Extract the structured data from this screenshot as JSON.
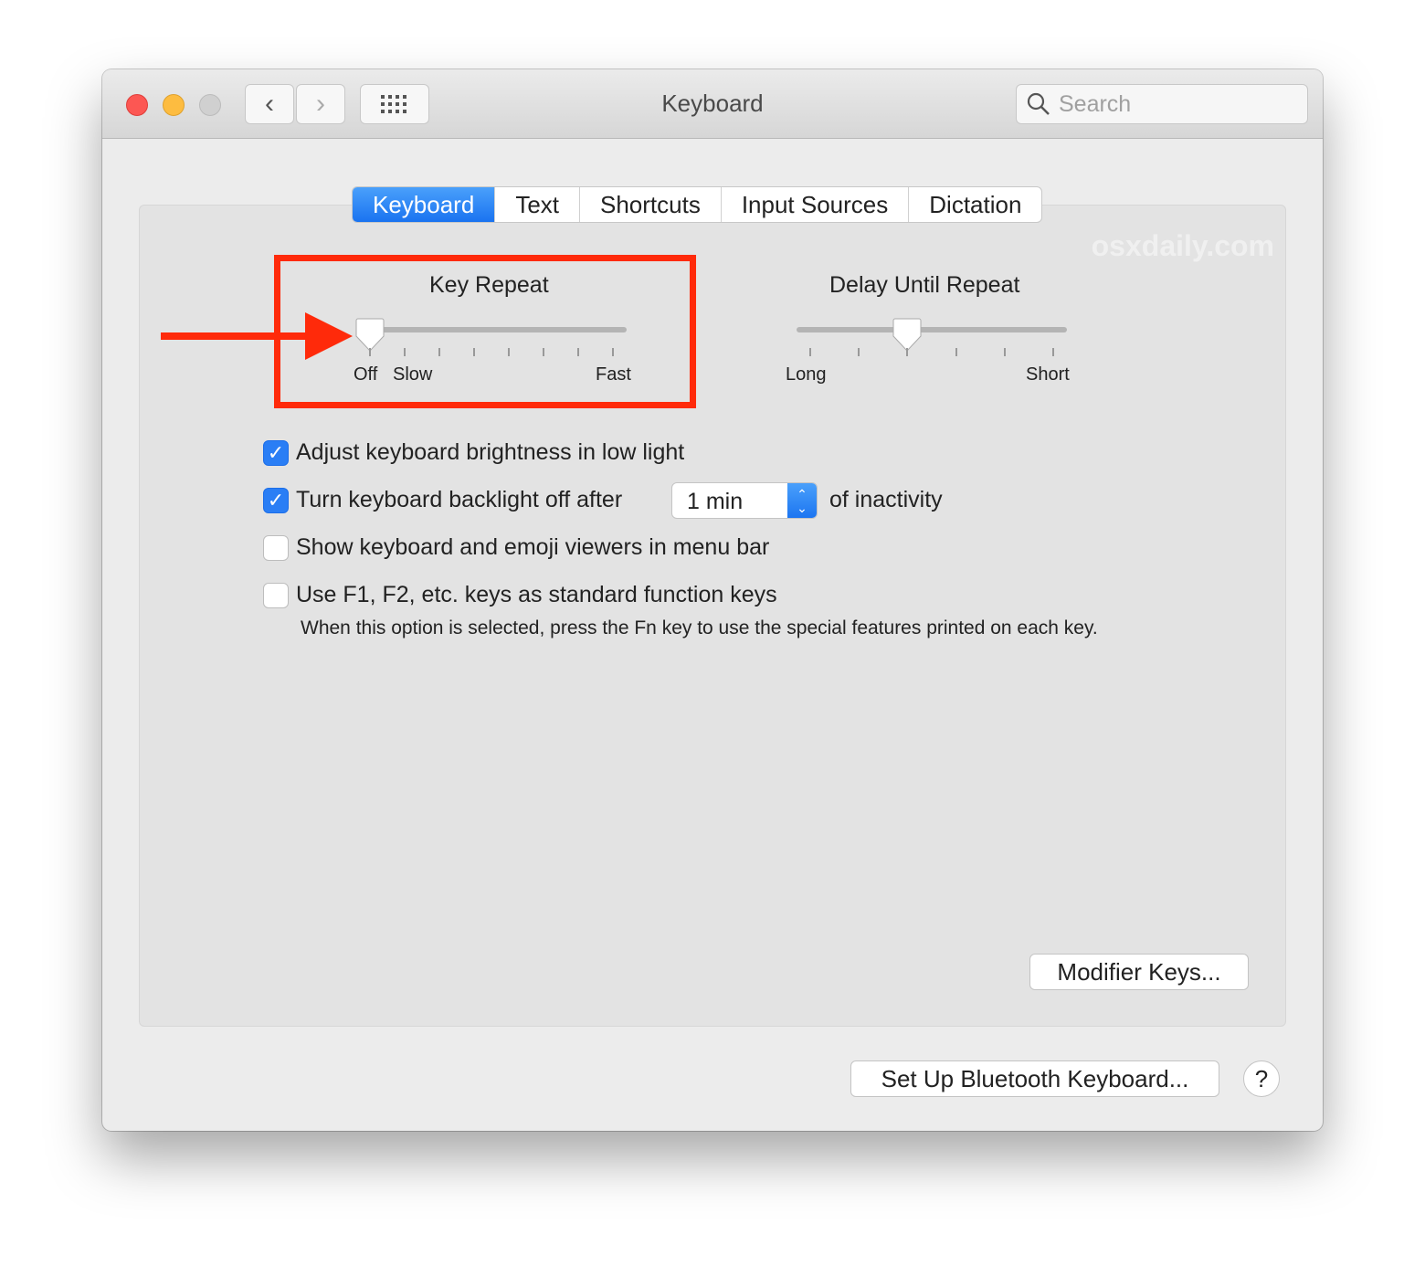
{
  "window": {
    "title": "Keyboard",
    "search_placeholder": "Search",
    "icons": [
      "back-icon",
      "forward-icon",
      "grid-icon",
      "search-icon"
    ]
  },
  "tabs": [
    {
      "label": "Keyboard",
      "active": true
    },
    {
      "label": "Text"
    },
    {
      "label": "Shortcuts"
    },
    {
      "label": "Input Sources"
    },
    {
      "label": "Dictation"
    }
  ],
  "watermark": "osxdaily.com",
  "key_repeat": {
    "title": "Key Repeat",
    "off": "Off",
    "slow": "Slow",
    "fast": "Fast",
    "ticks": 8,
    "value_index": 0
  },
  "delay": {
    "title": "Delay Until Repeat",
    "long": "Long",
    "short": "Short",
    "ticks": 6,
    "value_index": 2
  },
  "options": [
    {
      "label": "Adjust keyboard brightness in low light",
      "checked": true
    },
    {
      "label": "Turn keyboard backlight off after",
      "checked": true,
      "select": "1 min",
      "suffix": "of inactivity"
    },
    {
      "label": "Show keyboard and emoji viewers in menu bar",
      "checked": false
    },
    {
      "label": "Use F1, F2, etc. keys as standard function keys",
      "checked": false,
      "note": "When this option is selected, press the Fn key to use the special features printed on each key."
    }
  ],
  "buttons": {
    "modifier": "Modifier Keys...",
    "bluetooth": "Set Up Bluetooth Keyboard...",
    "help": "?"
  },
  "colors": {
    "annotation": "#ff2a0a",
    "accent": "#1a73f0"
  }
}
